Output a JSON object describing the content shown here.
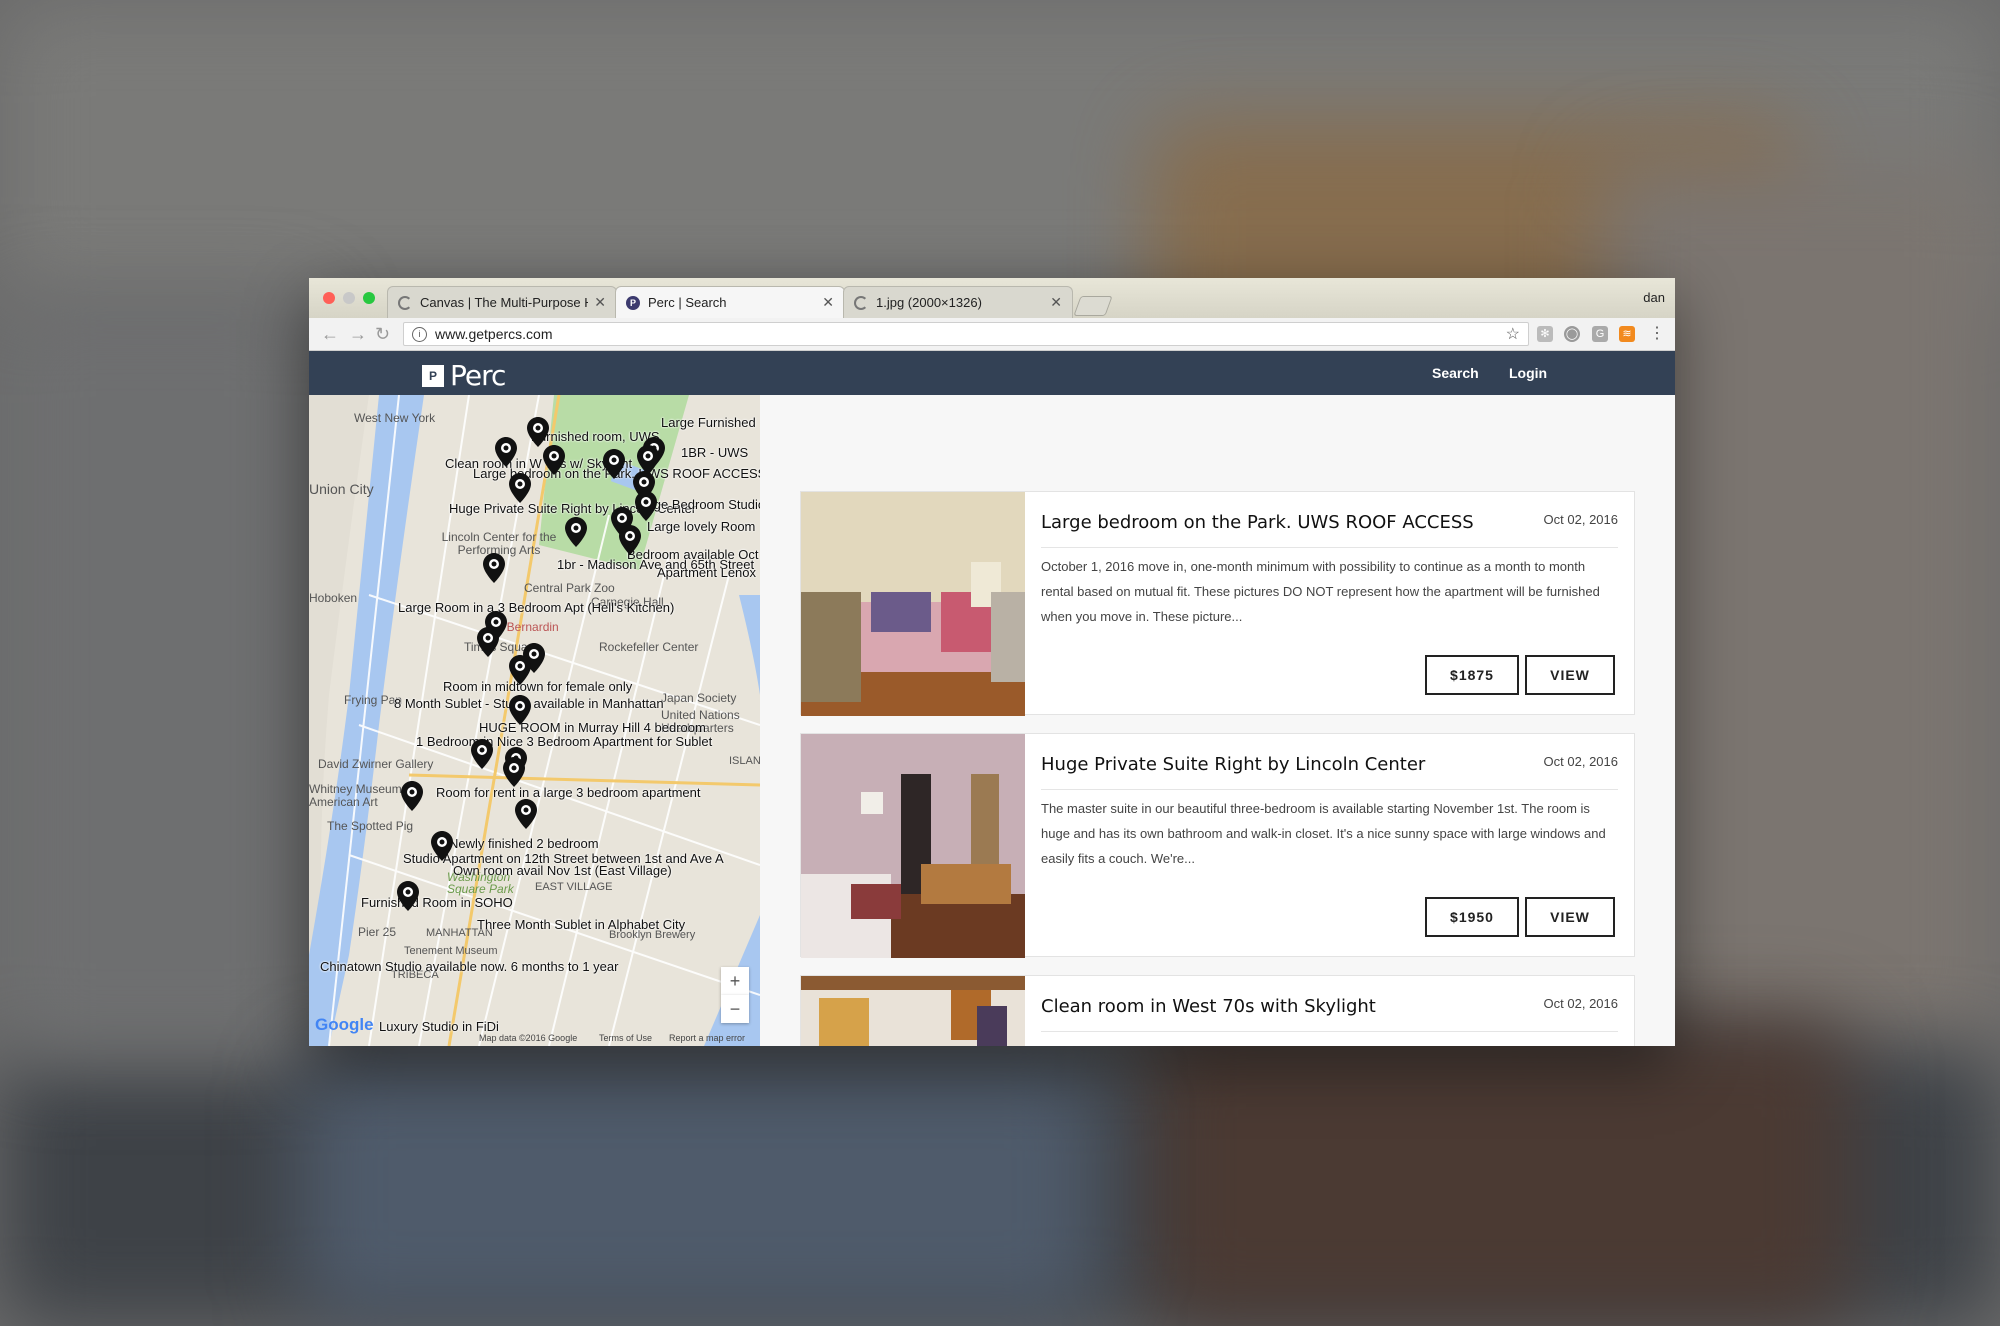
{
  "browser": {
    "tabs": [
      {
        "title": "Canvas | The Multi-Purpose H",
        "active": false,
        "icon": "loading-icon"
      },
      {
        "title": "Perc | Search",
        "active": true,
        "icon": "perc-favicon"
      },
      {
        "title": "1.jpg (2000×1326)",
        "active": false,
        "icon": "loading-icon"
      }
    ],
    "user": "dan",
    "url": "www.getpercs.com"
  },
  "site": {
    "logo_mark": "P",
    "logo_text": "Perc",
    "nav": {
      "search": "Search",
      "login": "Login"
    },
    "brand_color": "#334155"
  },
  "map": {
    "places": [
      "West New York",
      "Union City",
      "Hoboken",
      "Lincoln Center for the Performing Arts",
      "Central Park Zoo",
      "Carnegie Hall",
      "Le Bernardin",
      "Times Square",
      "Rockefeller Center",
      "Frying Pan",
      "Japan Society",
      "United Nations Headquarters",
      "David Zwirner Gallery",
      "Whitney Museum of American Art",
      "The Spotted Pig",
      "Washington Square Park",
      "EAST VILLAGE",
      "Pier 25",
      "MANHATTAN",
      "Brooklyn Brewery",
      "Tenement Museum",
      "TRIBECA",
      "ISLAND"
    ],
    "listing_labels": [
      "Large Furnished",
      "Furnished room, UWS",
      "Clean room in W 70s w/ Skylight",
      "Large bedroom on the Park. UWS ROOF ACCESS",
      "1BR - UWS",
      "Huge Private Suite Right by Lincoln Center",
      "Large Bedroom Studio",
      "Large lovely Room",
      "1br - Madison Ave and 65th Street",
      "Bedroom available Oct",
      "Apartment Lenox",
      "Large Room in a 3 Bedroom Apt (Hell's Kitchen)",
      "Room in midtown for female only",
      "8 Month Sublet - Studio available in Manhattan",
      "HUGE ROOM in Murray Hill 4 bedroom",
      "1 Bedroom in Nice 3 Bedroom Apartment for Sublet",
      "Room for rent in a large 3 bedroom apartment",
      "Newly finished 2 bedroom",
      "Studio Apartment on 12th Street between 1st and Ave A",
      "Own room avail Nov 1st (East Village)",
      "Furnished Room in SOHO",
      "Three Month Sublet in Alphabet City",
      "Chinatown Studio available now. 6 months to 1 year",
      "Luxury Studio in FiDi"
    ],
    "google": "Google",
    "attribution": {
      "data": "Map data ©2016 Google",
      "terms": "Terms of Use",
      "report": "Report a map error"
    },
    "zoom_in": "+",
    "zoom_out": "−"
  },
  "listings": [
    {
      "title": "Large bedroom on the Park. UWS ROOF ACCESS",
      "date": "Oct 02, 2016",
      "description": "October 1, 2016 move in, one-month minimum with possibility to continue as a month to month rental based on mutual fit. These pictures DO NOT represent how the apartment will be furnished when you move in. These picture...",
      "price": "$1875",
      "view_label": "VIEW"
    },
    {
      "title": "Huge Private Suite Right by Lincoln Center",
      "date": "Oct 02, 2016",
      "description": "The master suite in our beautiful three-bedroom is available starting November 1st. The room is huge and has its own bathroom and walk-in closet. It's a nice sunny space with large windows and easily fits a couch. We're...",
      "price": "$1950",
      "view_label": "VIEW"
    },
    {
      "title": "Clean room in West 70s with Skylight",
      "date": "Oct 02, 2016",
      "description": "",
      "price": "",
      "view_label": ""
    }
  ]
}
